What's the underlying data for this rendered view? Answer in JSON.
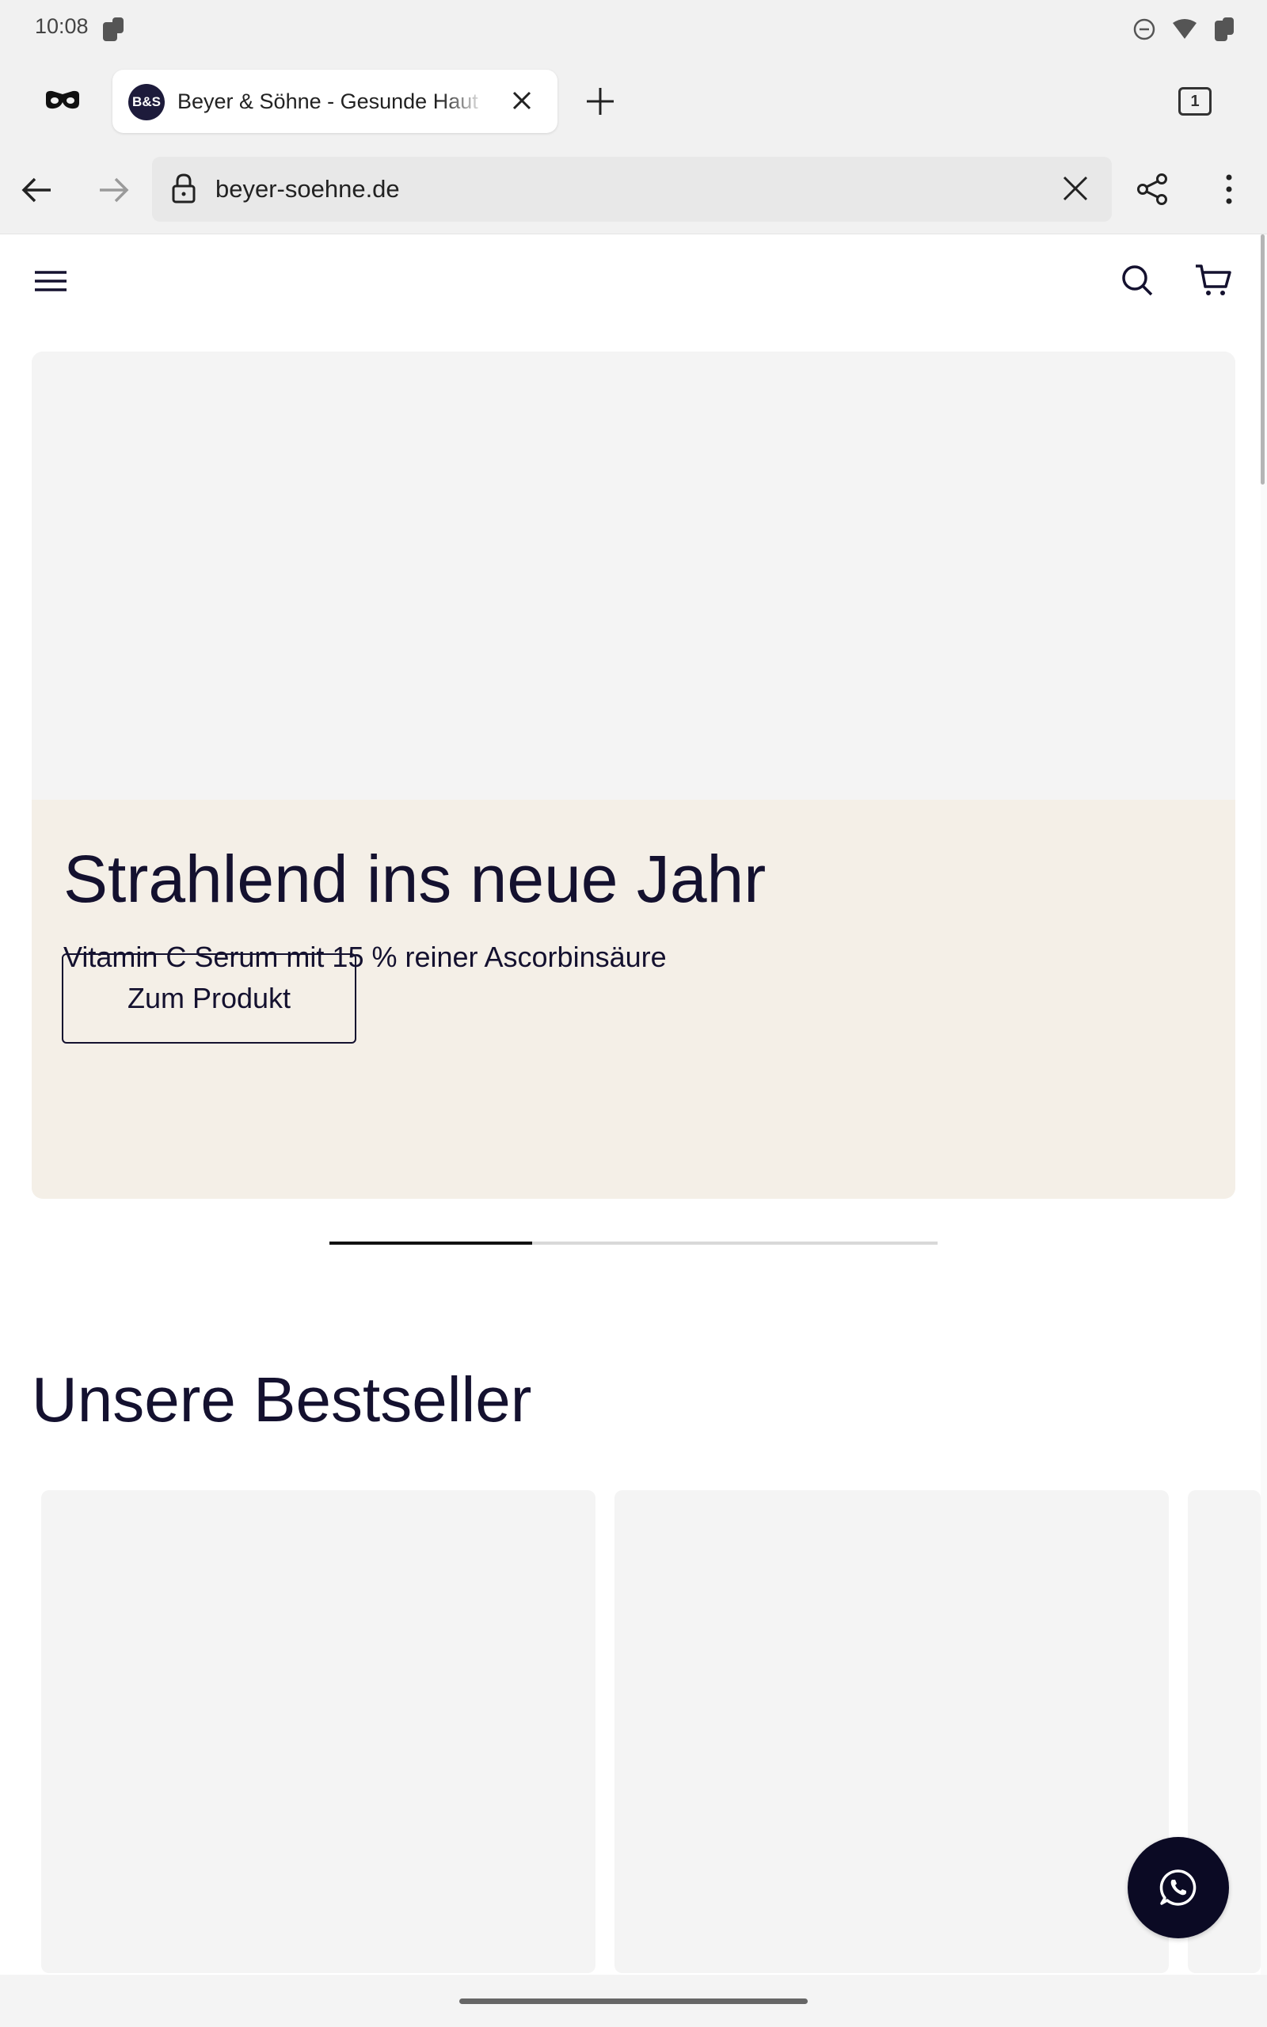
{
  "status_bar": {
    "time": "10:08"
  },
  "browser": {
    "tab": {
      "favicon_text": "B&S",
      "title": "Beyer & Söhne - Gesunde Haut"
    },
    "tab_count": "1",
    "url": "beyer-soehne.de"
  },
  "hero": {
    "title": "Strahlend ins neue Jahr",
    "subtitle": "Vitamin C Serum mit 15 % reiner Ascorbinsäure",
    "button_label": "Zum Produkt",
    "carousel_progress": 0.333
  },
  "bestsellers": {
    "title": "Unsere Bestseller"
  },
  "colors": {
    "brand_navy": "#14112f",
    "hero_panel": "#f4efe7",
    "whatsapp_button": "#0b0a24"
  }
}
